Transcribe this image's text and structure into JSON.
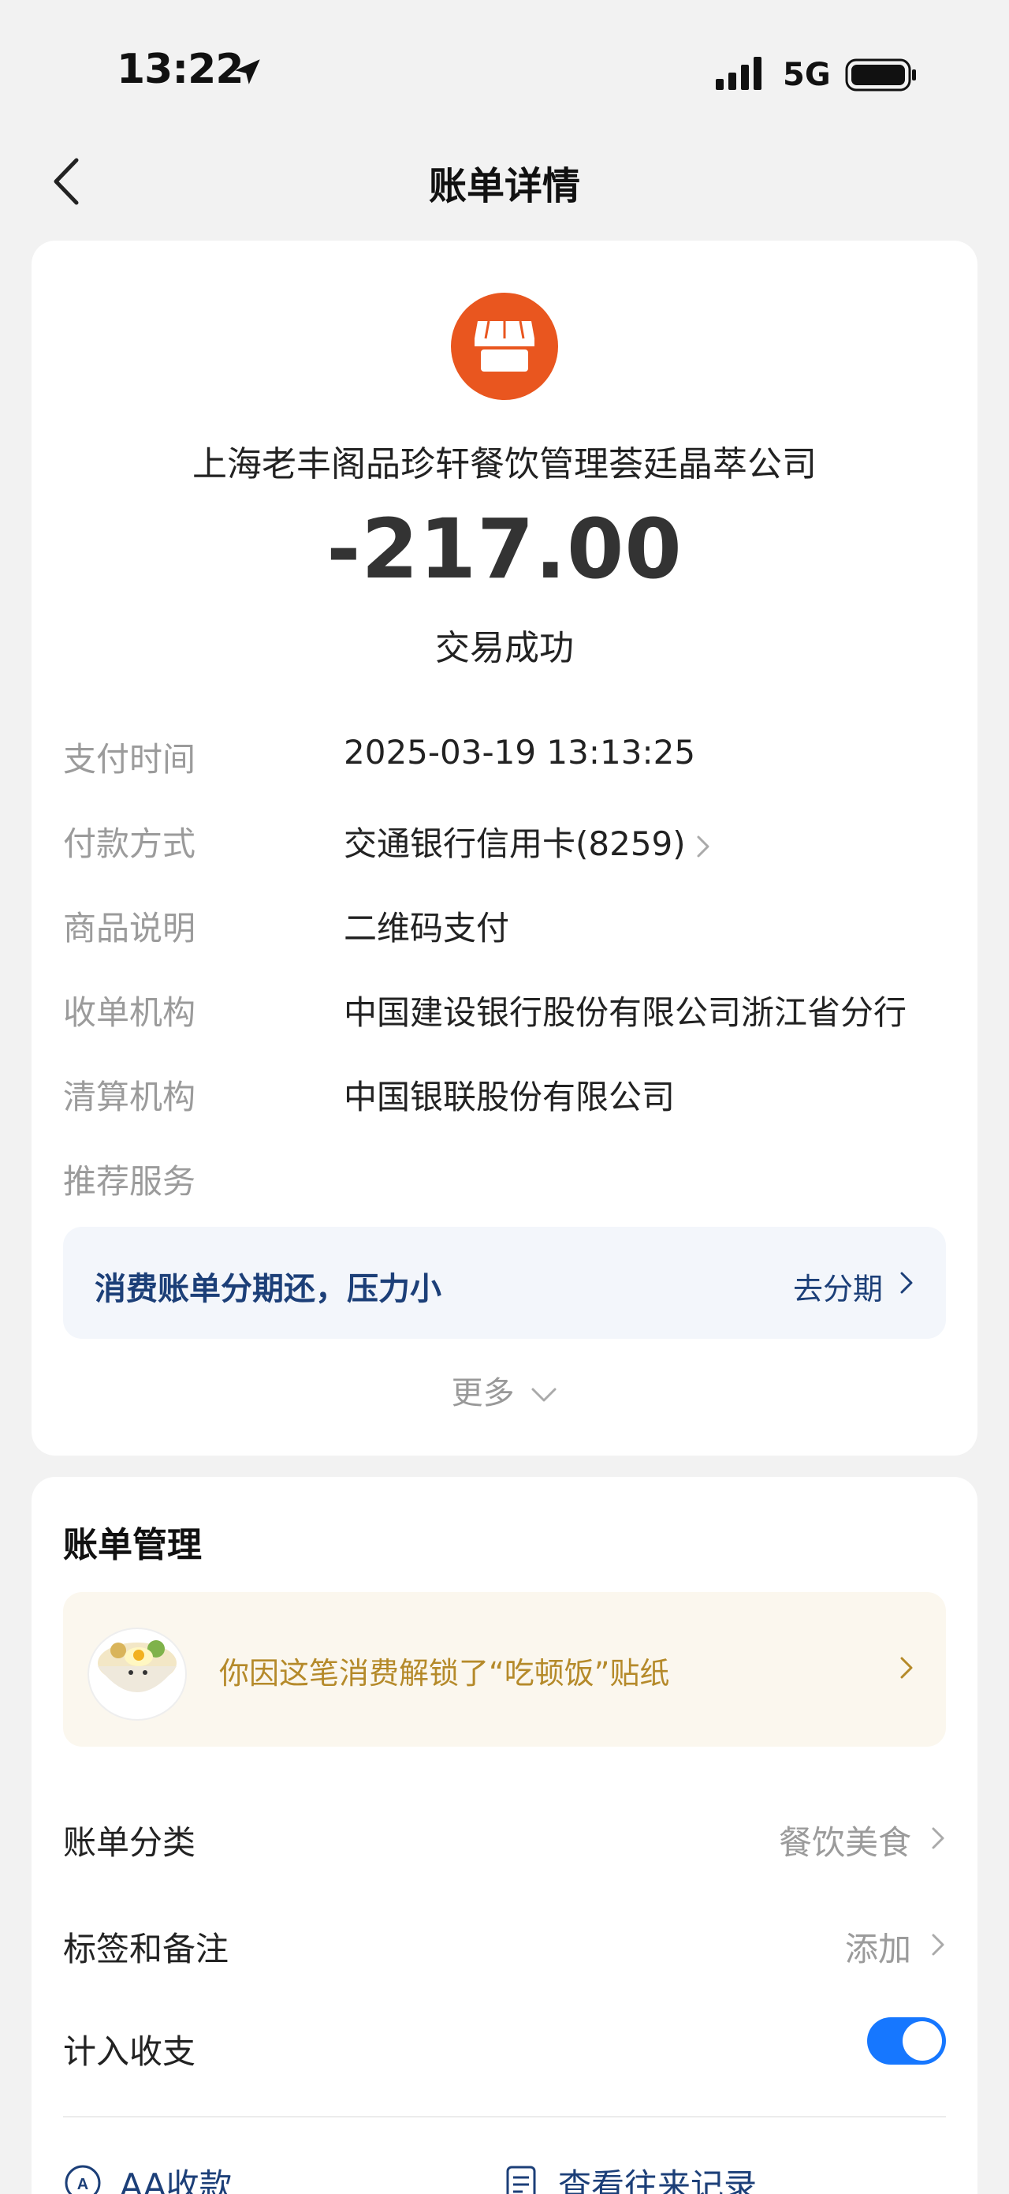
{
  "status_bar": {
    "time": "13:22",
    "network": "5G",
    "icons": [
      "location-arrow-icon",
      "signal-icon",
      "battery-icon"
    ]
  },
  "nav": {
    "title": "账单详情",
    "back_icon": "chevron-left-icon"
  },
  "transaction": {
    "merchant_icon": "store-icon",
    "merchant_color": "#e9561f",
    "merchant": "上海老丰阁品珍轩餐饮管理荟廷晶萃公司",
    "amount": "-217.00",
    "status": "交易成功"
  },
  "details": [
    {
      "label": "支付时间",
      "value": "2025-03-19 13:13:25"
    },
    {
      "label": "付款方式",
      "value": "交通银行信用卡(8259)"
    },
    {
      "label": "商品说明",
      "value": "二维码支付"
    },
    {
      "label": "收单机构",
      "value": "中国建设银行股份有限公司浙江省分行"
    },
    {
      "label": "清算机构",
      "value": "中国银联股份有限公司"
    },
    {
      "label": "推荐服务",
      "value": ""
    }
  ],
  "promo": {
    "text": "消费账单分期还，压力小",
    "action": "去分期",
    "color": "#1c3f78"
  },
  "more": {
    "label": "更多"
  },
  "management": {
    "title": "账单管理",
    "sticker": {
      "text": "你因这笔消费解锁了“吃顿饭”贴纸",
      "icon": "rice-bowl-sticker-icon"
    },
    "category": {
      "label": "账单分类",
      "value": "餐饮美食"
    },
    "tags": {
      "label": "标签和备注",
      "value": "添加"
    },
    "income": {
      "label": "计入收支",
      "enabled": true,
      "toggle_color": "#1677ff"
    },
    "actions": [
      {
        "label": "AA收款",
        "icon": "aa-icon"
      },
      {
        "label": "查看往来记录",
        "icon": "records-icon"
      }
    ]
  }
}
